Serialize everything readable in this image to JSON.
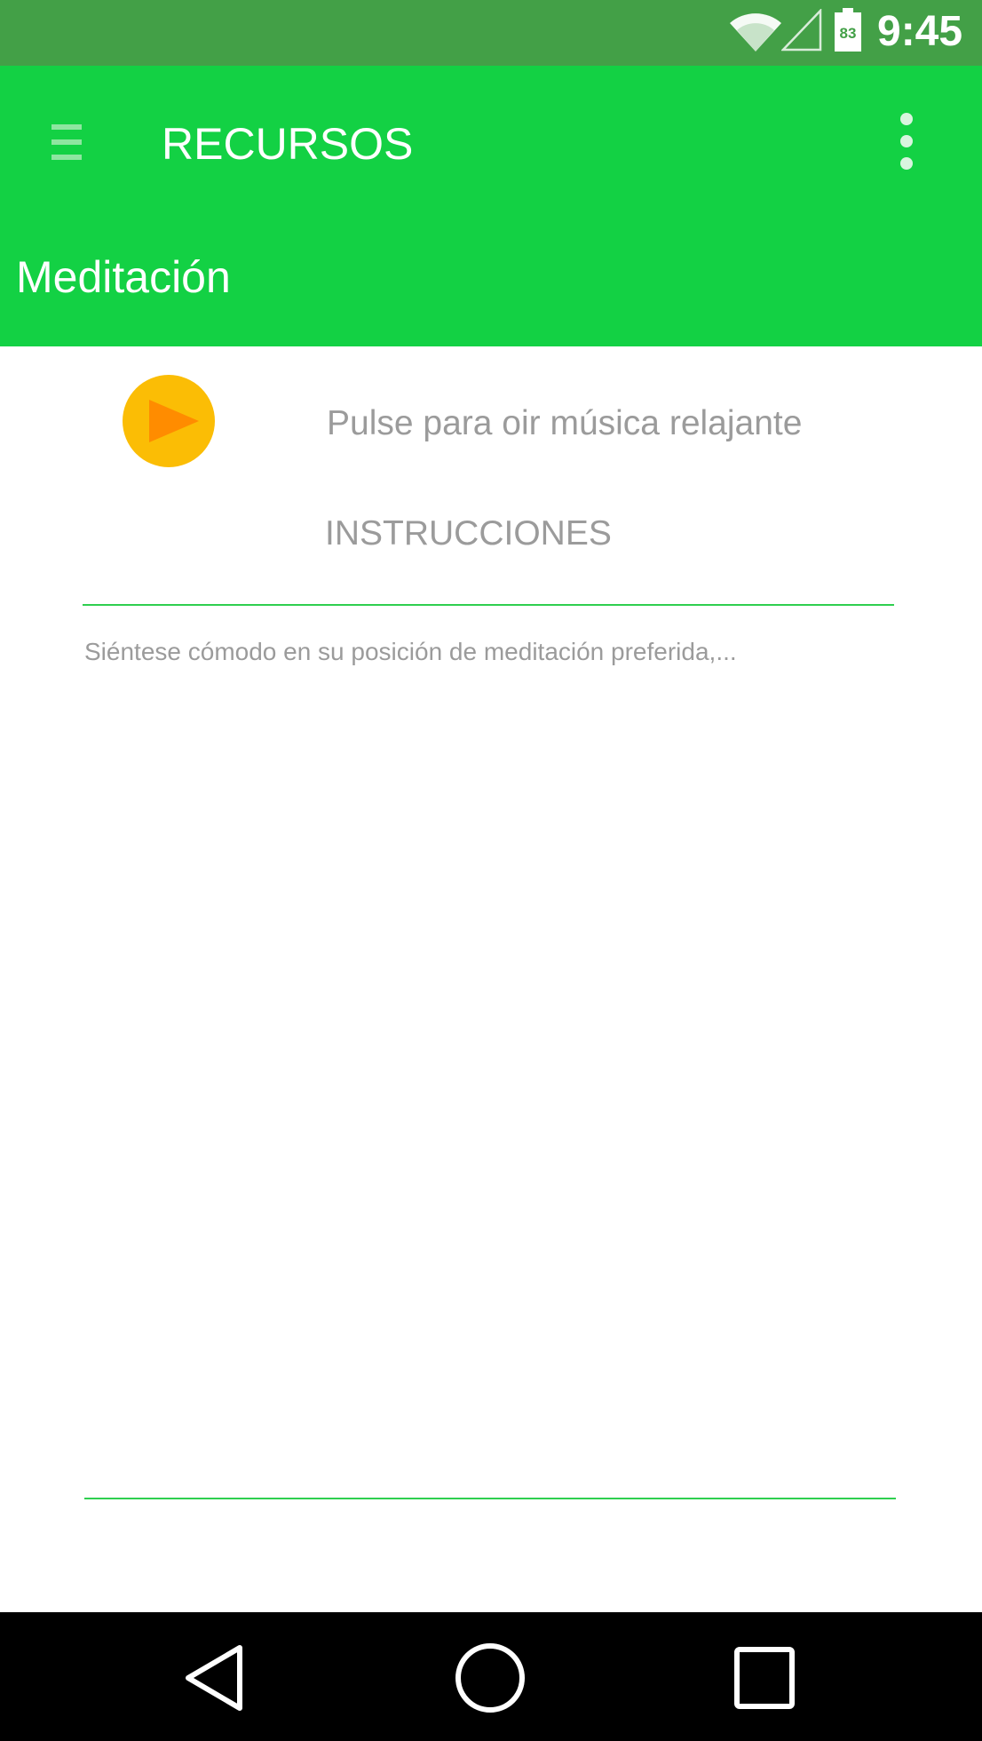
{
  "status_bar": {
    "time": "9:45",
    "battery_level": "83",
    "icons": [
      "wifi-icon",
      "signal-icon",
      "battery-icon"
    ]
  },
  "toolbar": {
    "title": "RECURSOS",
    "menu_icon": "menu-icon",
    "overflow_icon": "overflow-icon"
  },
  "section": {
    "title": "Meditación"
  },
  "content": {
    "play_icon": "play-icon",
    "play_caption": "Pulse para oir música relajante",
    "instructions_heading": "INSTRUCCIONES",
    "instructions_text": "Siéntese cómodo en su posición de meditación preferida,..."
  },
  "nav_bar": {
    "icons": [
      "back-icon",
      "home-icon",
      "recents-icon"
    ]
  },
  "colors": {
    "status_bar": "#43a047",
    "primary": "#13d144",
    "accent_play": "#fbbd05",
    "play_triangle": "#ff8c00",
    "text_secondary": "#9b9b9b",
    "divider": "#2fcf4f"
  }
}
